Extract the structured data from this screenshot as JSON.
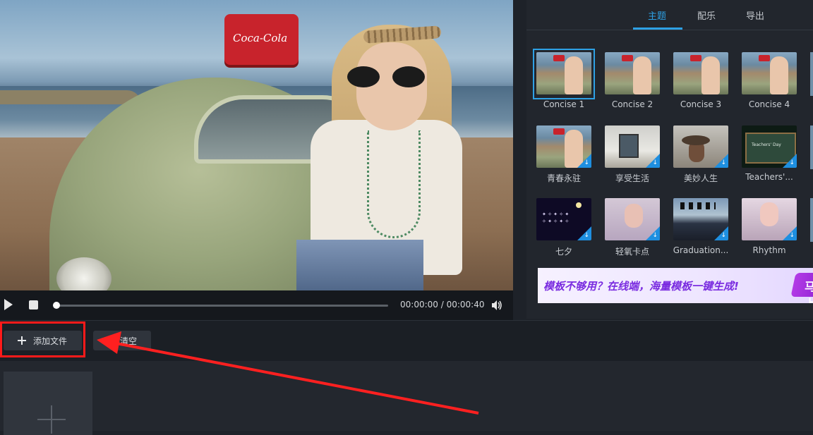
{
  "preview": {
    "time_display": "00:00:00 / 00:00:40",
    "roof_box_text": "Coca-Cola"
  },
  "panel": {
    "tabs": [
      {
        "label": "主题",
        "active": true
      },
      {
        "label": "配乐",
        "active": false
      },
      {
        "label": "导出",
        "active": false
      }
    ],
    "themes": [
      {
        "label": "Concise 1",
        "selected": true,
        "download": false
      },
      {
        "label": "Concise 2",
        "selected": false,
        "download": false
      },
      {
        "label": "Concise 3",
        "selected": false,
        "download": false
      },
      {
        "label": "Concise 4",
        "selected": false,
        "download": false
      },
      {
        "label": "青春永驻",
        "selected": false,
        "download": true
      },
      {
        "label": "享受生活",
        "selected": false,
        "download": true
      },
      {
        "label": "美妙人生",
        "selected": false,
        "download": true
      },
      {
        "label": "Teachers'...",
        "selected": false,
        "download": true
      },
      {
        "label": "七夕",
        "selected": false,
        "download": true
      },
      {
        "label": "轻氧卡点",
        "selected": false,
        "download": true
      },
      {
        "label": "Graduation...",
        "selected": false,
        "download": true
      },
      {
        "label": "Rhythm",
        "selected": false,
        "download": true
      }
    ],
    "teachers_thumb_text": "Teachers' Day",
    "banner": {
      "text": "模板不够用？在线端，海量模板一键生成!",
      "button": "马上"
    }
  },
  "toolbar": {
    "add_label": "添加文件",
    "clear_label": "清空"
  },
  "colors": {
    "accent": "#2ea1e5",
    "highlight": "#ff1a1a",
    "download_badge": "#1e8fe0"
  }
}
